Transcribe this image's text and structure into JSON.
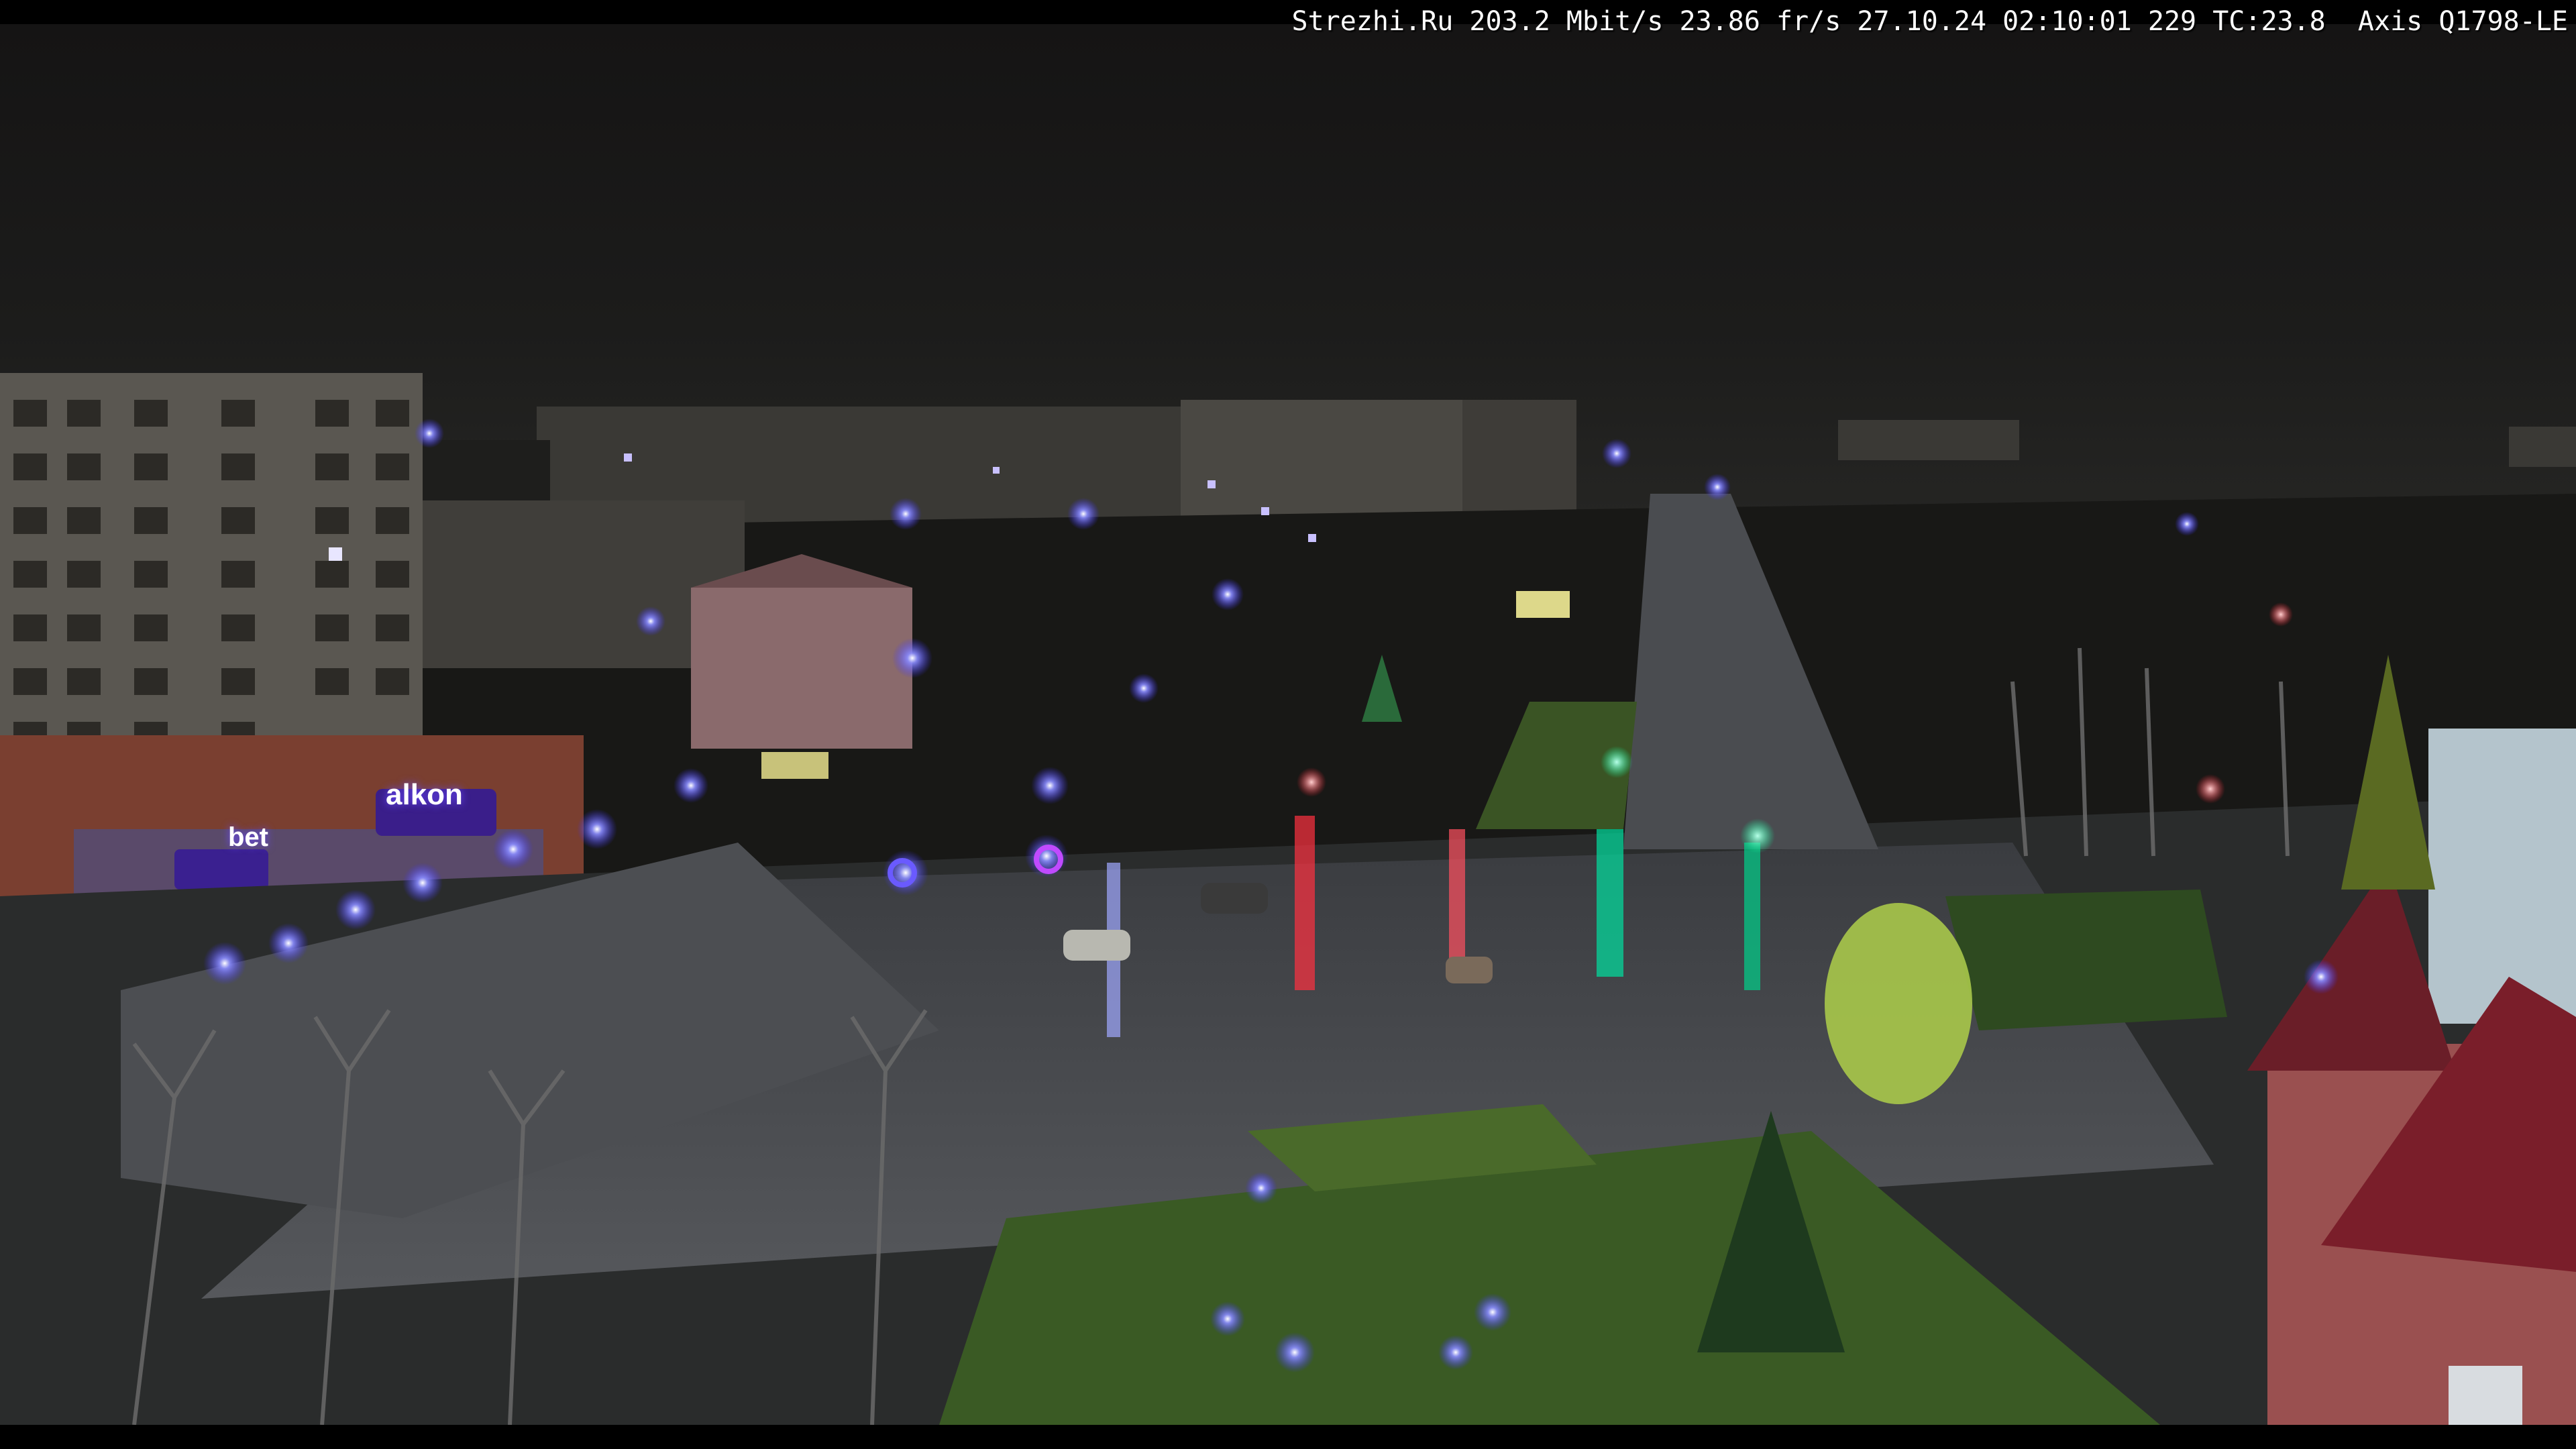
{
  "overlay": {
    "text": "Strezhi.Ru 203.2 Mbit/s 23.86 fr/s 27.10.24 02:10:01 229 TC:23.8  Axis Q1798-LE"
  },
  "signs": {
    "store_main": "alkon",
    "store_sub": "bet"
  }
}
